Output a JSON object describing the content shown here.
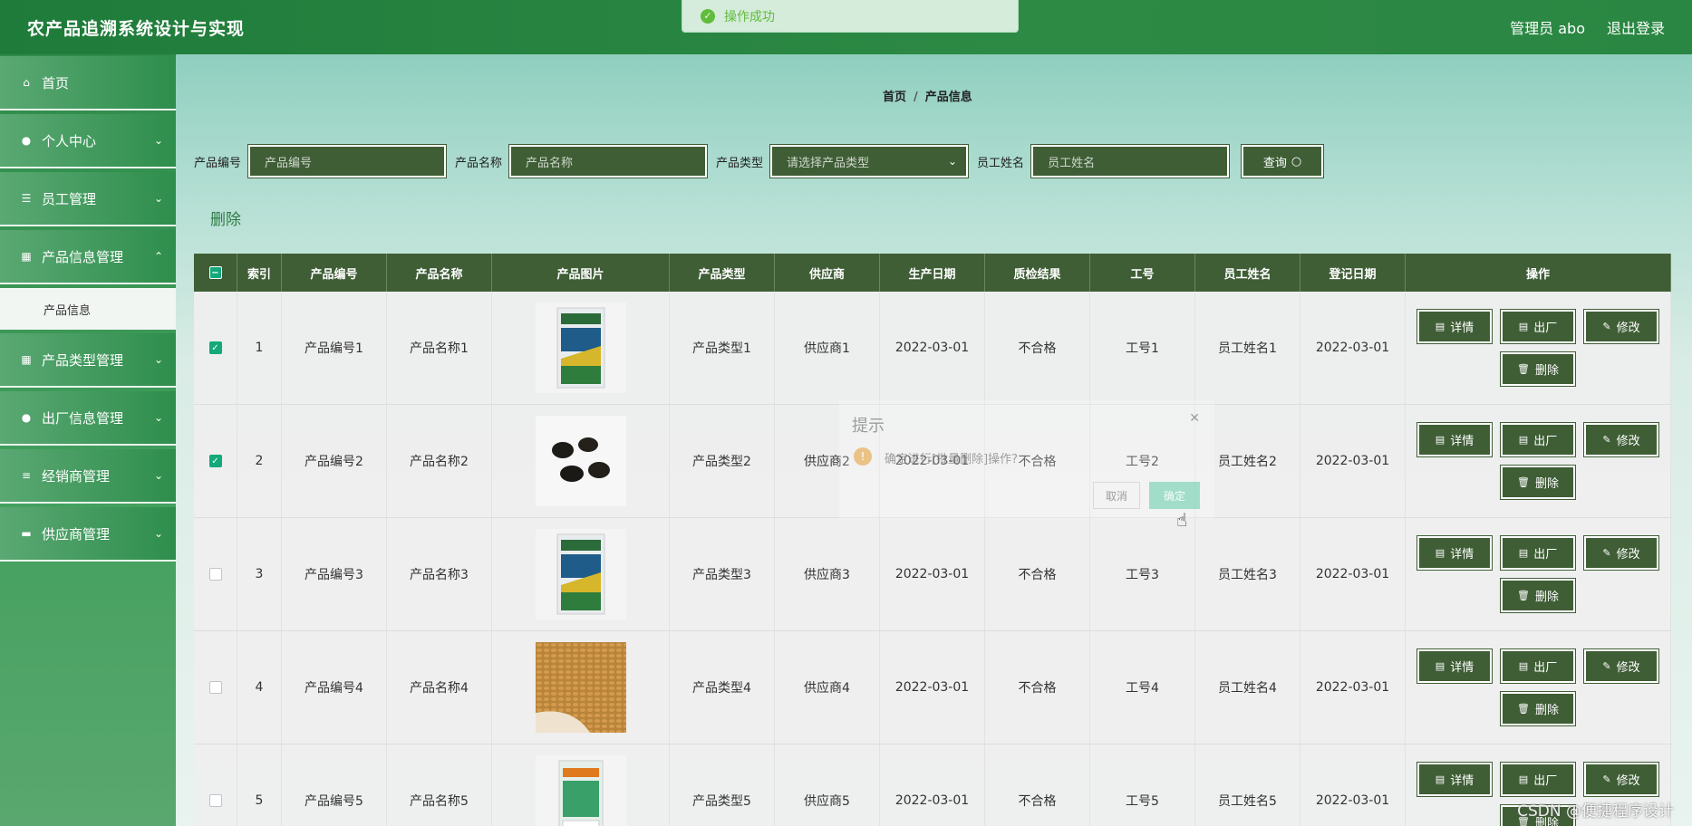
{
  "header": {
    "title": "农产品追溯系统设计与实现",
    "user": "管理员 abo",
    "logout": "退出登录"
  },
  "toast": {
    "message": "操作成功"
  },
  "sidebar": {
    "items": [
      {
        "label": "首页",
        "icon": "home-icon"
      },
      {
        "label": "个人中心",
        "icon": "user-icon"
      },
      {
        "label": "员工管理",
        "icon": "sliders-icon"
      },
      {
        "label": "产品信息管理",
        "icon": "grid-icon",
        "expanded": true
      },
      {
        "label": "产品类型管理",
        "icon": "grid-icon"
      },
      {
        "label": "出厂信息管理",
        "icon": "location-icon"
      },
      {
        "label": "经销商管理",
        "icon": "list-icon"
      },
      {
        "label": "供应商管理",
        "icon": "briefcase-icon"
      }
    ],
    "sub_item": "产品信息"
  },
  "breadcrumb": {
    "home": "首页",
    "current": "产品信息"
  },
  "search": {
    "code_label": "产品编号",
    "code_placeholder": "产品编号",
    "name_label": "产品名称",
    "name_placeholder": "产品名称",
    "type_label": "产品类型",
    "type_placeholder": "请选择产品类型",
    "staff_label": "员工姓名",
    "staff_placeholder": "员工姓名",
    "query_button": "查询"
  },
  "bulk_delete": "删除",
  "table": {
    "headers": [
      "索引",
      "产品编号",
      "产品名称",
      "产品图片",
      "产品类型",
      "供应商",
      "生产日期",
      "质检结果",
      "工号",
      "员工姓名",
      "登记日期",
      "操作"
    ],
    "rows": [
      {
        "index": "1",
        "code": "产品编号1",
        "name": "产品名称1",
        "type": "产品类型1",
        "supplier": "供应商1",
        "prod_date": "2022-03-01",
        "qc": "不合格",
        "staff_no": "工号1",
        "staff_name": "员工姓名1",
        "reg_date": "2022-03-01",
        "checked": true,
        "image": "bag"
      },
      {
        "index": "2",
        "code": "产品编号2",
        "name": "产品名称2",
        "type": "产品类型2",
        "supplier": "供应商2",
        "prod_date": "2022-03-01",
        "qc": "不合格",
        "staff_no": "工号2",
        "staff_name": "员工姓名2",
        "reg_date": "2022-03-01",
        "checked": true,
        "image": "seeds"
      },
      {
        "index": "3",
        "code": "产品编号3",
        "name": "产品名称3",
        "type": "产品类型3",
        "supplier": "供应商3",
        "prod_date": "2022-03-01",
        "qc": "不合格",
        "staff_no": "工号3",
        "staff_name": "员工姓名3",
        "reg_date": "2022-03-01",
        "checked": false,
        "image": "bag"
      },
      {
        "index": "4",
        "code": "产品编号4",
        "name": "产品名称4",
        "type": "产品类型4",
        "supplier": "供应商4",
        "prod_date": "2022-03-01",
        "qc": "不合格",
        "staff_no": "工号4",
        "staff_name": "员工姓名4",
        "reg_date": "2022-03-01",
        "checked": false,
        "image": "wheat"
      },
      {
        "index": "5",
        "code": "产品编号5",
        "name": "产品名称5",
        "type": "产品类型5",
        "supplier": "供应商5",
        "prod_date": "2022-03-01",
        "qc": "不合格",
        "staff_no": "工号5",
        "staff_name": "员工姓名5",
        "reg_date": "2022-03-01",
        "checked": false,
        "image": "bag2"
      }
    ],
    "actions": {
      "detail": "详情",
      "ship": "出厂",
      "edit": "修改",
      "delete": "删除"
    }
  },
  "dialog": {
    "title": "提示",
    "message": "确定进行[批量删除]操作?",
    "cancel": "取消",
    "confirm": "确定"
  },
  "watermark": "CSDN @便捷程序设计",
  "colors": {
    "header": "#2d8a45",
    "button": "#3f5e36",
    "checkbox": "#13a97a"
  }
}
